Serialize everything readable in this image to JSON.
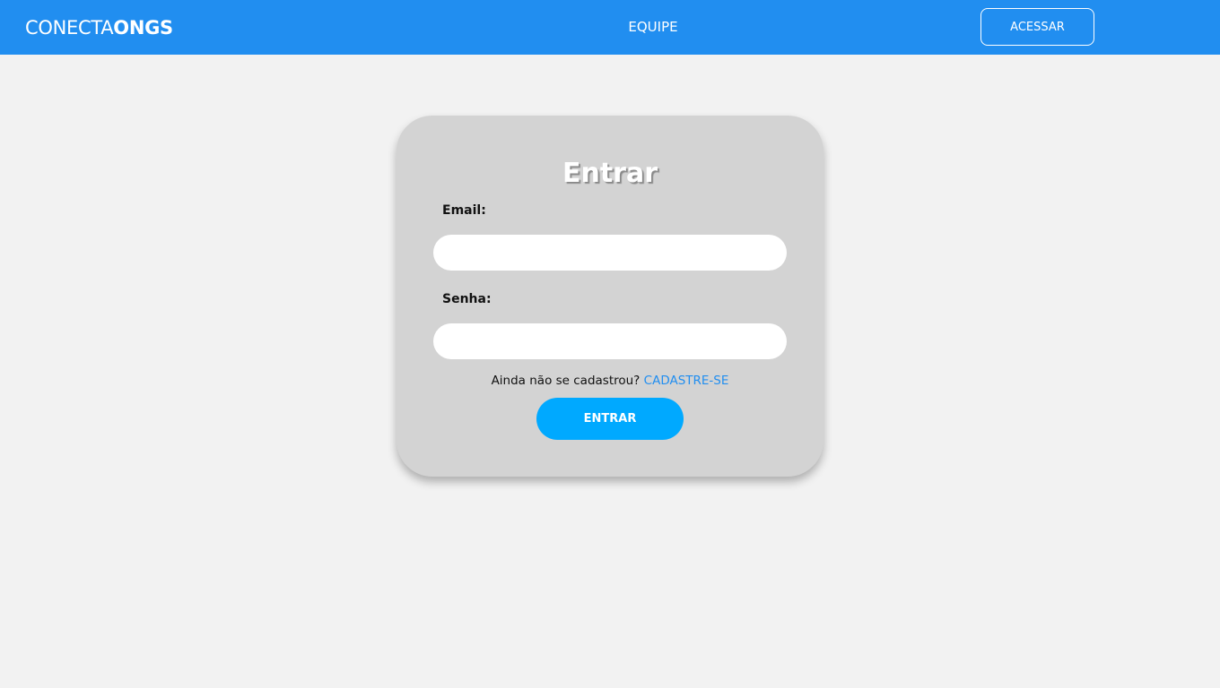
{
  "header": {
    "brand_light": "CONECTA",
    "brand_bold": "ONGS",
    "nav_link": "EQUIPE",
    "access_label": "ACESSAR"
  },
  "login": {
    "title": "Entrar",
    "email_label": "Email:",
    "email_value": "",
    "password_label": "Senha:",
    "password_value": "",
    "signup_prompt": "Ainda não se cadastrou?",
    "signup_link": "CADASTRE-SE",
    "submit_label": "ENTRAR"
  },
  "colors": {
    "header_bg": "#218ef0",
    "page_bg": "#f2f2f2",
    "card_bg": "#d3d3d3",
    "button_bg": "#00a9ff",
    "link": "#218ef0"
  }
}
